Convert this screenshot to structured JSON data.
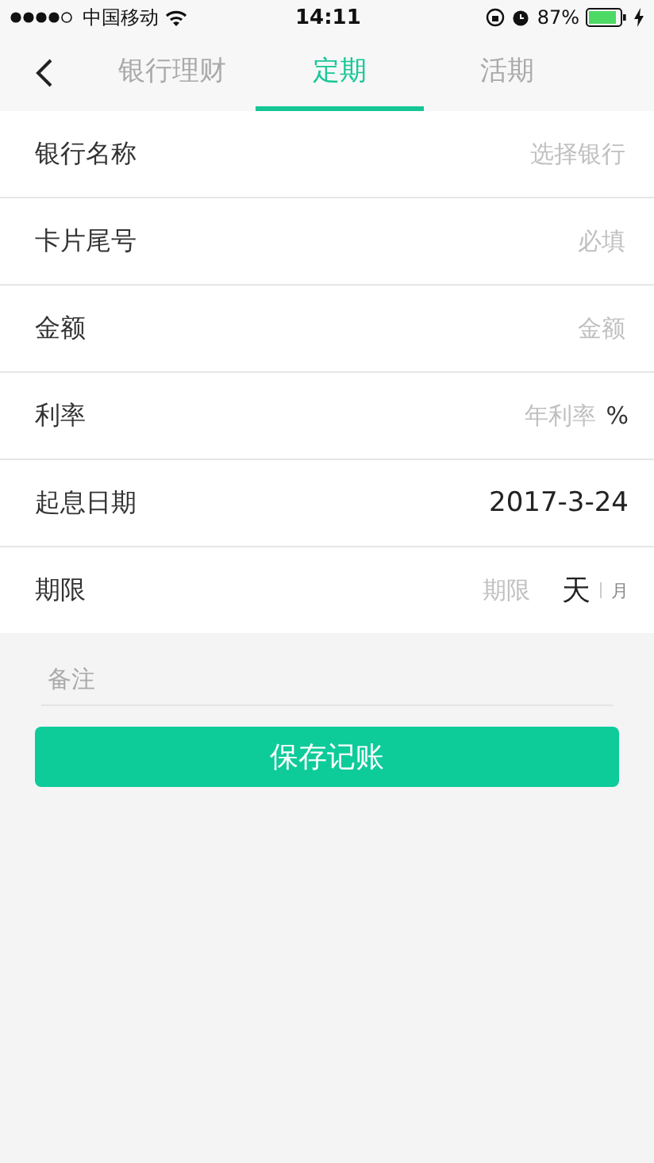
{
  "status_bar": {
    "carrier": "中国移动",
    "time": "14:11",
    "battery": "87%"
  },
  "tabs": [
    {
      "label": "银行理财",
      "selected": false
    },
    {
      "label": "定期",
      "selected": true
    },
    {
      "label": "活期",
      "selected": false
    }
  ],
  "rows": [
    {
      "label": "银行名称",
      "kind": "input",
      "placeholder": "选择银行"
    },
    {
      "label": "卡片尾号",
      "kind": "input",
      "placeholder": "必填"
    },
    {
      "label": "金额",
      "kind": "input",
      "placeholder": "金额"
    },
    {
      "label": "利率",
      "kind": "input",
      "placeholder": "年利率",
      "suffix": "%"
    },
    {
      "label": "起息日期",
      "kind": "value",
      "value": "2017-3-24"
    },
    {
      "label": "期限",
      "kind": "period",
      "placeholder": "期限",
      "units": [
        {
          "label": "天",
          "selected": true
        },
        {
          "label": "月",
          "selected": false
        }
      ]
    }
  ],
  "note": {
    "placeholder": "备注"
  },
  "save_button": "保存记账"
}
